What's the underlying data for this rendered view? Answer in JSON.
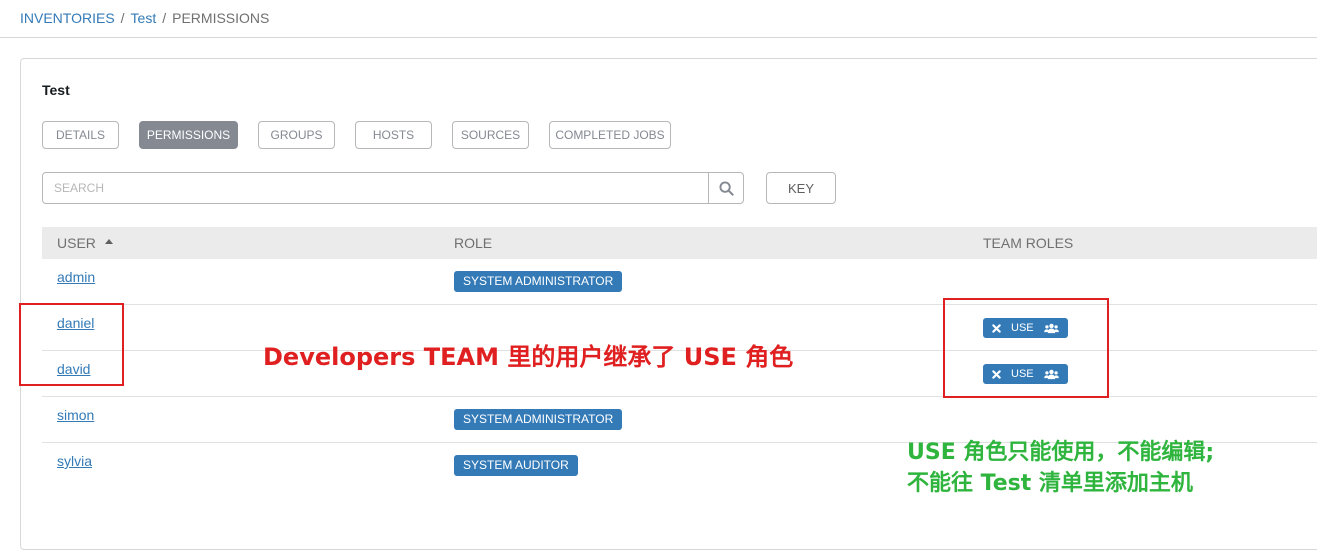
{
  "breadcrumb": {
    "items": [
      {
        "label": "INVENTORIES"
      },
      {
        "label": "Test"
      },
      {
        "label": "PERMISSIONS"
      }
    ],
    "separator": "/"
  },
  "panel": {
    "title": "Test",
    "tabs": [
      {
        "label": "DETAILS",
        "active": false
      },
      {
        "label": "PERMISSIONS",
        "active": true
      },
      {
        "label": "GROUPS",
        "active": false
      },
      {
        "label": "HOSTS",
        "active": false
      },
      {
        "label": "SOURCES",
        "active": false
      },
      {
        "label": "COMPLETED JOBS",
        "active": false
      }
    ]
  },
  "search": {
    "placeholder": "SEARCH",
    "value": "",
    "icon": "search-icon",
    "key_label": "KEY"
  },
  "table": {
    "headers": {
      "user": "USER",
      "role": "ROLE",
      "team_roles": "TEAM ROLES"
    },
    "sort_indicator": "ascending",
    "rows": [
      {
        "user": "admin",
        "role": "SYSTEM ADMINISTRATOR",
        "team_role": ""
      },
      {
        "user": "daniel",
        "role": "",
        "team_role": "USE"
      },
      {
        "user": "david",
        "role": "",
        "team_role": "USE"
      },
      {
        "user": "simon",
        "role": "SYSTEM ADMINISTRATOR",
        "team_role": ""
      },
      {
        "user": "sylvia",
        "role": "SYSTEM AUDITOR",
        "team_role": ""
      }
    ]
  },
  "annotations": {
    "red_text": "Developers TEAM 里的用户继承了 USE 角色",
    "green_line1": "USE 角色只能使用，不能编辑;",
    "green_line2": "不能往 Test 清单里添加主机"
  },
  "colors": {
    "link": "#337ab7",
    "badge": "#337ab7",
    "active_tab": "#848992",
    "annotation_red": "#e02020",
    "annotation_green": "#2fb53e"
  }
}
